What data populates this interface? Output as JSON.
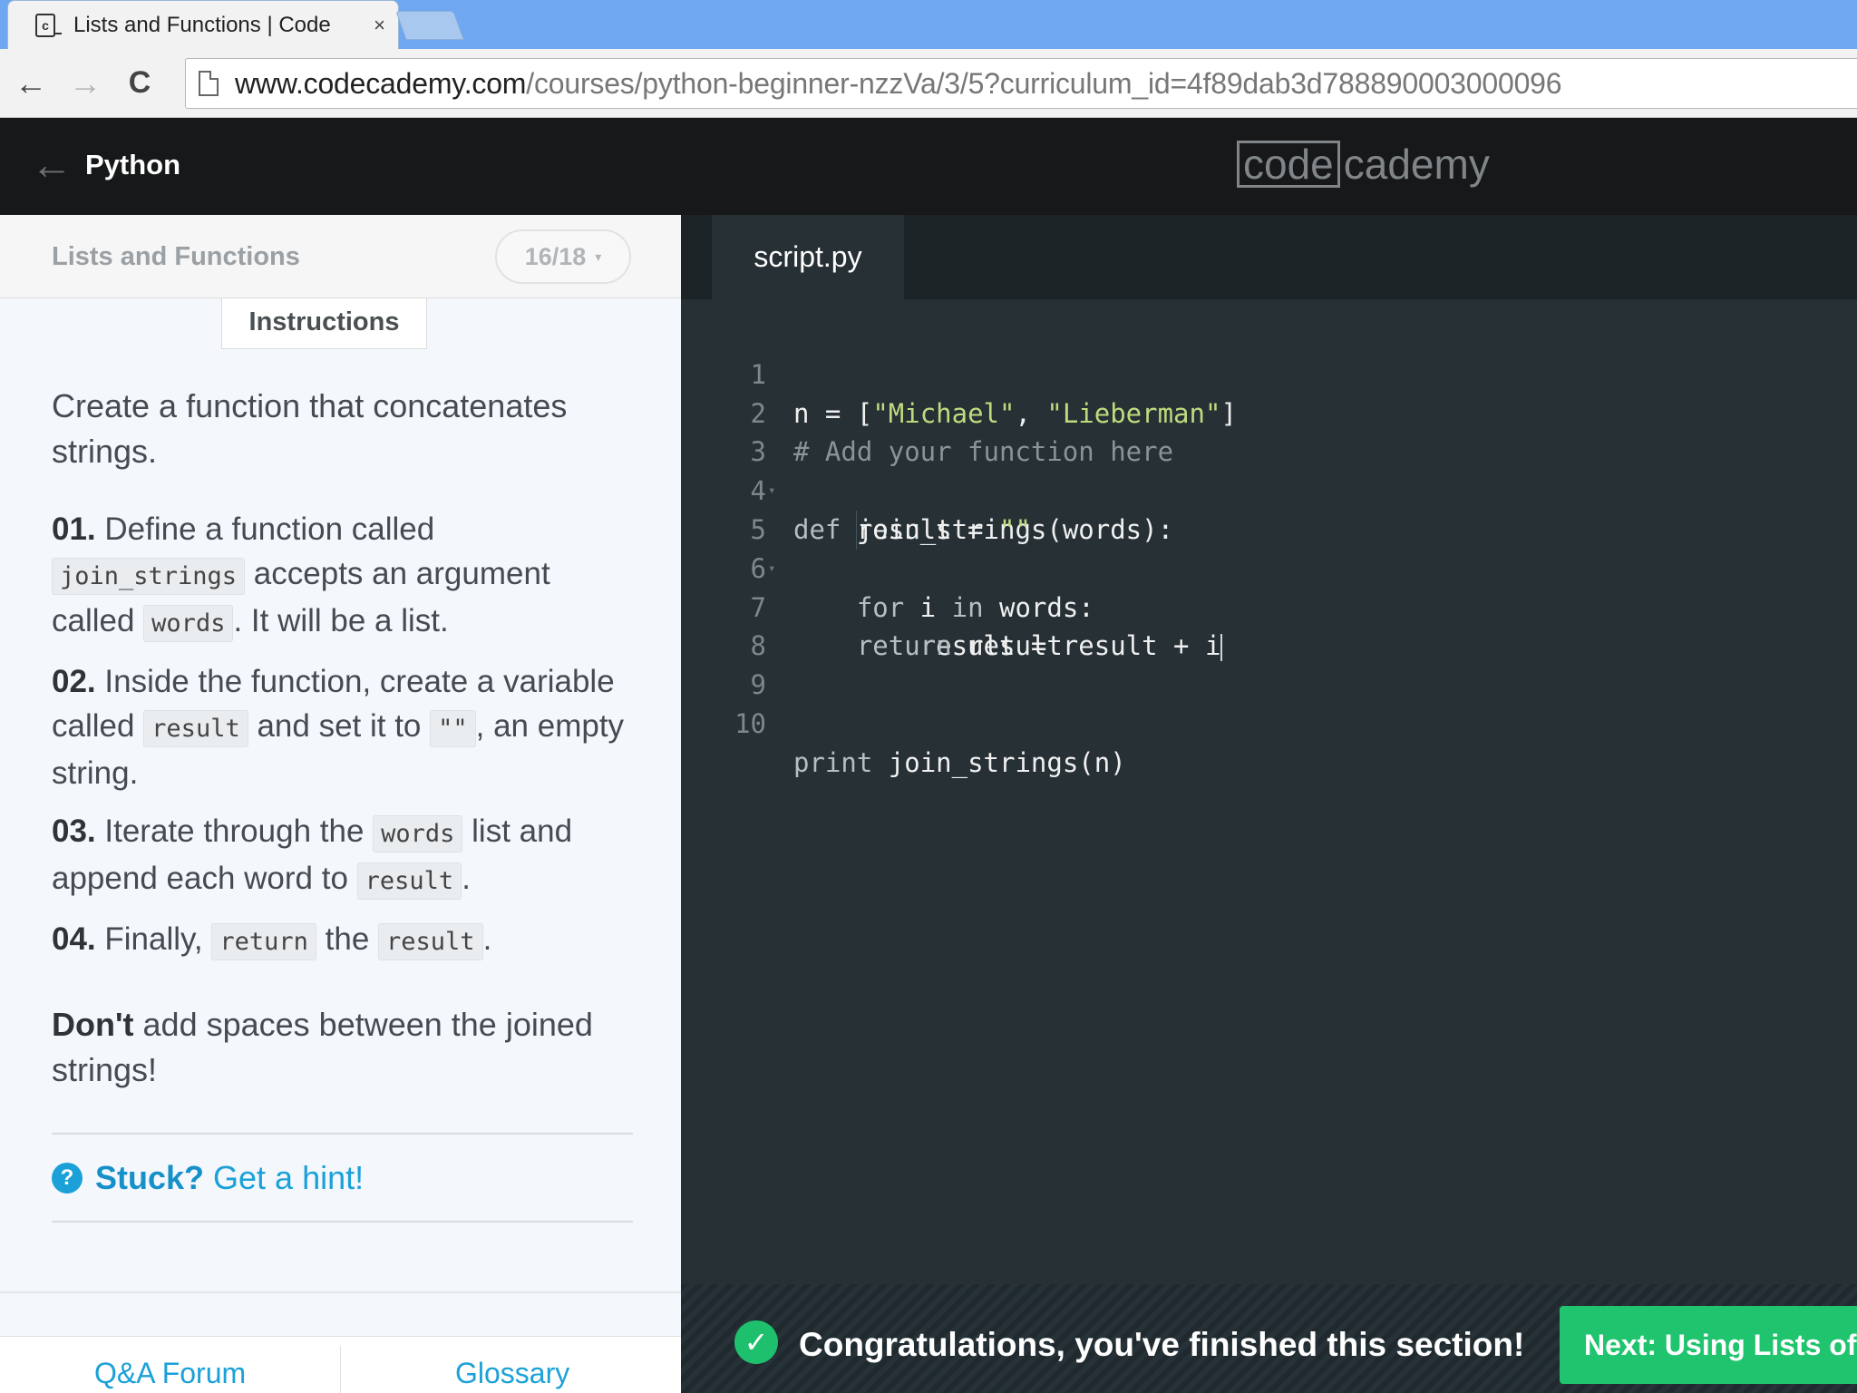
{
  "browser": {
    "tab_title": "Lists and Functions | Code",
    "tab_close": "×",
    "favicon_letter": "c",
    "back_glyph": "←",
    "forward_glyph": "→",
    "reload_glyph": "C",
    "url_host": "www.codecademy.com",
    "url_path": "/courses/python-beginner-nzzVa/3/5?curriculum_id=4f89dab3d788890003000096"
  },
  "header": {
    "back_glyph": "←",
    "course_title": "Python",
    "logo_boxed": "code",
    "logo_rest": "cademy"
  },
  "lesson": {
    "title": "Lists and Functions",
    "progress": "16/18",
    "progress_caret": "▾",
    "instructions_tab": "Instructions",
    "intro": "Create a function that concatenates strings.",
    "steps": [
      {
        "num": "01.",
        "t1": " Define a function called ",
        "c1": "join_strings",
        "t2": " accepts an argument called ",
        "c2": "words",
        "t3": ". It will be a list."
      },
      {
        "num": "02.",
        "t1": " Inside the function, create a variable called ",
        "c1": "result",
        "t2": " and set it to ",
        "c2": "\"\"",
        "t3": ", an empty string."
      },
      {
        "num": "03.",
        "t1": " Iterate through the ",
        "c1": "words",
        "t2": " list and append each word to ",
        "c2": "result",
        "t3": "."
      },
      {
        "num": "04.",
        "t1": " Finally, ",
        "c1": "return",
        "t2": " the ",
        "c2": "result",
        "t3": "."
      }
    ],
    "note_bold": "Don't",
    "note_rest": " add spaces between the joined strings!",
    "help_glyph": "?",
    "stuck": "Stuck?",
    "hint": "Get a hint!",
    "footer_links": [
      "Q&A Forum",
      "Glossary"
    ]
  },
  "editor": {
    "file_tab": "script.py",
    "line_numbers": [
      "1",
      "2",
      "3",
      "4",
      "5",
      "6",
      "7",
      "8",
      "9",
      "10"
    ],
    "code": {
      "l1_a": "n = [",
      "l1_s1": "\"Michael\"",
      "l1_b": ", ",
      "l1_s2": "\"Lieberman\"",
      "l1_c": "]",
      "l2": "# Add your function here",
      "l3_kw": "def",
      "l3_rest": " join_strings(words):",
      "l4_a": "    result = ",
      "l4_s": "\"\"",
      "l5_kw": "    for",
      "l5_b": " i ",
      "l5_kw2": "in",
      "l5_c": " words:",
      "l6": "        result = result + i",
      "l7_kw": "    return",
      "l7_b": " result",
      "l10_kw": "print",
      "l10_b": " join_strings(n)"
    },
    "fold_glyph": "▾"
  },
  "congrats": {
    "check_glyph": "✓",
    "message": "Congratulations, you've finished this section!",
    "next_button": "Next: Using Lists of Lists in Functions"
  },
  "colors": {
    "editor_bg": "#263035",
    "header_bg": "#161819",
    "accent_green": "#20c46e",
    "link_blue": "#1ba1d8",
    "string_green": "#bedb7e"
  }
}
